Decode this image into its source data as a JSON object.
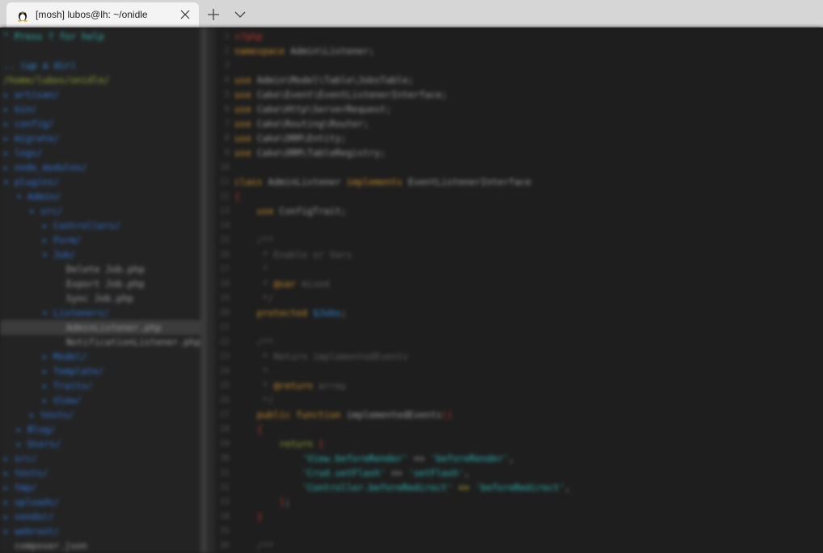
{
  "window": {
    "tab_title": "[mosh] lubos@lh: ~/onidle",
    "icons": {
      "tab_icon": "linux-tux-icon",
      "close": "close-icon",
      "new_tab": "plus-icon",
      "dropdown": "chevron-down-icon"
    }
  },
  "tree": {
    "help": "\" Press ? for help",
    "up": ".. (up a dir)",
    "root": "/home/lubos/onidle/",
    "items": [
      {
        "arrow": "▸",
        "name": "artisan/",
        "kind": "dir",
        "indent": 0
      },
      {
        "arrow": "▸",
        "name": "bin/",
        "kind": "dir",
        "indent": 0
      },
      {
        "arrow": "▸",
        "name": "config/",
        "kind": "dir",
        "indent": 0
      },
      {
        "arrow": "▸",
        "name": "migrate/",
        "kind": "dir",
        "indent": 0
      },
      {
        "arrow": "▸",
        "name": "logs/",
        "kind": "dir",
        "indent": 0
      },
      {
        "arrow": "▸",
        "name": "node_modules/",
        "kind": "dir",
        "indent": 0
      },
      {
        "arrow": "▾",
        "name": "plugins/",
        "kind": "dir",
        "indent": 0
      },
      {
        "arrow": "▾",
        "name": "Admin/",
        "kind": "dir",
        "indent": 1
      },
      {
        "arrow": "▾",
        "name": "src/",
        "kind": "dir",
        "indent": 2
      },
      {
        "arrow": "▸",
        "name": "Controllers/",
        "kind": "dir",
        "indent": 3
      },
      {
        "arrow": "▸",
        "name": "Form/",
        "kind": "dir",
        "indent": 3
      },
      {
        "arrow": "▾",
        "name": "Job/",
        "kind": "dir",
        "indent": 3
      },
      {
        "arrow": "",
        "name": "Delete Job.php",
        "kind": "file",
        "indent": 4
      },
      {
        "arrow": "",
        "name": "Export Job.php",
        "kind": "file",
        "indent": 4
      },
      {
        "arrow": "",
        "name": "Sync Job.php",
        "kind": "file",
        "indent": 4
      },
      {
        "arrow": "▾",
        "name": "Listeners/",
        "kind": "dir",
        "indent": 3
      },
      {
        "arrow": "",
        "name": "AdminListener.php",
        "kind": "file",
        "indent": 4,
        "selected": true
      },
      {
        "arrow": "",
        "name": "NotificationListener.php",
        "kind": "file",
        "indent": 4
      },
      {
        "arrow": "▸",
        "name": "Model/",
        "kind": "dir",
        "indent": 3
      },
      {
        "arrow": "▸",
        "name": "Template/",
        "kind": "dir",
        "indent": 3
      },
      {
        "arrow": "▸",
        "name": "Traits/",
        "kind": "dir",
        "indent": 3
      },
      {
        "arrow": "▸",
        "name": "View/",
        "kind": "dir",
        "indent": 3
      },
      {
        "arrow": "▸",
        "name": "tests/",
        "kind": "dir",
        "indent": 2
      },
      {
        "arrow": "▸",
        "name": "Blog/",
        "kind": "dir",
        "indent": 1
      },
      {
        "arrow": "▸",
        "name": "Users/",
        "kind": "dir",
        "indent": 1
      },
      {
        "arrow": "▸",
        "name": "src/",
        "kind": "dir",
        "indent": 0
      },
      {
        "arrow": "▸",
        "name": "tests/",
        "kind": "dir",
        "indent": 0
      },
      {
        "arrow": "▸",
        "name": "tmp/",
        "kind": "dir",
        "indent": 0
      },
      {
        "arrow": "▸",
        "name": "uploads/",
        "kind": "dir",
        "indent": 0
      },
      {
        "arrow": "▸",
        "name": "vendor/",
        "kind": "dir",
        "indent": 0
      },
      {
        "arrow": "▸",
        "name": "webroot/",
        "kind": "dir",
        "indent": 0
      },
      {
        "arrow": "",
        "name": "composer.json",
        "kind": "file",
        "indent": 0
      }
    ]
  },
  "editor": {
    "first_lineno": "1",
    "lines": [
      {
        "no": "1",
        "parts": [
          {
            "t": "<?php",
            "c": "k-red"
          }
        ]
      },
      {
        "no": "2",
        "parts": [
          {
            "t": "namespace",
            "c": "k-kw"
          },
          {
            "t": " Admin\\Listener;",
            "c": "k-cls"
          }
        ]
      },
      {
        "no": "3",
        "parts": []
      },
      {
        "no": "4",
        "parts": [
          {
            "t": "use",
            "c": "k-kw"
          },
          {
            "t": " Admin\\Model\\Table\\JobsTable;",
            "c": "k-cls"
          }
        ]
      },
      {
        "no": "5",
        "parts": [
          {
            "t": "use",
            "c": "k-kw"
          },
          {
            "t": " Cake\\Event\\EventListenerInterface;",
            "c": "k-cls"
          }
        ]
      },
      {
        "no": "6",
        "parts": [
          {
            "t": "use",
            "c": "k-kw"
          },
          {
            "t": " Cake\\Http\\ServerRequest;",
            "c": "k-cls"
          }
        ]
      },
      {
        "no": "7",
        "parts": [
          {
            "t": "use",
            "c": "k-kw"
          },
          {
            "t": " Cake\\Routing\\Router;",
            "c": "k-cls"
          }
        ]
      },
      {
        "no": "8",
        "parts": [
          {
            "t": "use",
            "c": "k-kw"
          },
          {
            "t": " Cake\\ORM\\Entity;",
            "c": "k-cls"
          }
        ]
      },
      {
        "no": "9",
        "parts": [
          {
            "t": "use",
            "c": "k-kw"
          },
          {
            "t": " Cake\\ORM\\TableRegistry;",
            "c": "k-cls"
          }
        ]
      },
      {
        "no": "10",
        "parts": []
      },
      {
        "no": "11",
        "parts": [
          {
            "t": "class",
            "c": "k-kw"
          },
          {
            "t": " AdminListener ",
            "c": "k-cls"
          },
          {
            "t": "implements",
            "c": "k-kw"
          },
          {
            "t": " EventListenerInterface",
            "c": "k-cls"
          }
        ]
      },
      {
        "no": "12",
        "parts": [
          {
            "t": "{",
            "c": "k-red"
          }
        ]
      },
      {
        "no": "13",
        "parts": [
          {
            "t": "    use",
            "c": "k-kw"
          },
          {
            "t": " ConfigTrait;",
            "c": "k-cls"
          }
        ]
      },
      {
        "no": "14",
        "parts": []
      },
      {
        "no": "15",
        "parts": [
          {
            "t": "    /**",
            "c": "k-com"
          }
        ]
      },
      {
        "no": "16",
        "parts": [
          {
            "t": "     * Enable or Vars",
            "c": "k-com"
          }
        ]
      },
      {
        "no": "17",
        "parts": [
          {
            "t": "     *",
            "c": "k-com"
          }
        ]
      },
      {
        "no": "18",
        "parts": [
          {
            "t": "     * ",
            "c": "k-com"
          },
          {
            "t": "@var",
            "c": "k-kw"
          },
          {
            "t": " mixed",
            "c": "k-com"
          }
        ]
      },
      {
        "no": "19",
        "parts": [
          {
            "t": "     */",
            "c": "k-com"
          }
        ]
      },
      {
        "no": "20",
        "parts": [
          {
            "t": "    protected",
            "c": "k-kw"
          },
          {
            "t": " $",
            "c": "k-var"
          },
          {
            "t": "Jobs",
            "c": "k-var"
          },
          {
            "t": ";",
            "c": "k-cls"
          }
        ]
      },
      {
        "no": "21",
        "parts": []
      },
      {
        "no": "22",
        "parts": [
          {
            "t": "    /**",
            "c": "k-com"
          }
        ]
      },
      {
        "no": "23",
        "parts": [
          {
            "t": "     * Return implementedEvents",
            "c": "k-com"
          }
        ]
      },
      {
        "no": "24",
        "parts": [
          {
            "t": "     *",
            "c": "k-com"
          }
        ]
      },
      {
        "no": "25",
        "parts": [
          {
            "t": "     * ",
            "c": "k-com"
          },
          {
            "t": "@return",
            "c": "k-kw"
          },
          {
            "t": " array",
            "c": "k-com"
          }
        ]
      },
      {
        "no": "26",
        "parts": [
          {
            "t": "     */",
            "c": "k-com"
          }
        ]
      },
      {
        "no": "27",
        "parts": [
          {
            "t": "    public",
            "c": "k-kw"
          },
          {
            "t": " function",
            "c": "k-kw"
          },
          {
            "t": " implementedEvents",
            "c": "k-cls"
          },
          {
            "t": "()",
            "c": "k-red"
          }
        ]
      },
      {
        "no": "28",
        "parts": [
          {
            "t": "    {",
            "c": "k-red"
          }
        ]
      },
      {
        "no": "29",
        "parts": [
          {
            "t": "        return",
            "c": "k-fn"
          },
          {
            "t": " [",
            "c": "k-red"
          }
        ]
      },
      {
        "no": "30",
        "parts": [
          {
            "t": "            'View.beforeRender'",
            "c": "k-str"
          },
          {
            "t": " => ",
            "c": "k-cls"
          },
          {
            "t": "'beforeRender'",
            "c": "k-str"
          },
          {
            "t": ",",
            "c": "k-cls"
          }
        ]
      },
      {
        "no": "31",
        "parts": [
          {
            "t": "            'Crud.setFlash'",
            "c": "k-str"
          },
          {
            "t": " => ",
            "c": "k-cls"
          },
          {
            "t": "'setFlash'",
            "c": "k-str"
          },
          {
            "t": ",",
            "c": "k-cls"
          }
        ]
      },
      {
        "no": "32",
        "parts": [
          {
            "t": "            'Controller.beforeRedirect'",
            "c": "k-str"
          },
          {
            "t": " => ",
            "c": "k-yel"
          },
          {
            "t": "'beforeRedirect'",
            "c": "k-str"
          },
          {
            "t": ",",
            "c": "k-cls"
          }
        ]
      },
      {
        "no": "33",
        "parts": [
          {
            "t": "        ]",
            "c": "k-red"
          },
          {
            "t": ";",
            "c": "k-cls"
          }
        ]
      },
      {
        "no": "34",
        "parts": [
          {
            "t": "    }",
            "c": "k-red"
          }
        ]
      },
      {
        "no": "35",
        "parts": []
      },
      {
        "no": "36",
        "parts": [
          {
            "t": "    /**",
            "c": "k-com"
          }
        ]
      }
    ]
  }
}
